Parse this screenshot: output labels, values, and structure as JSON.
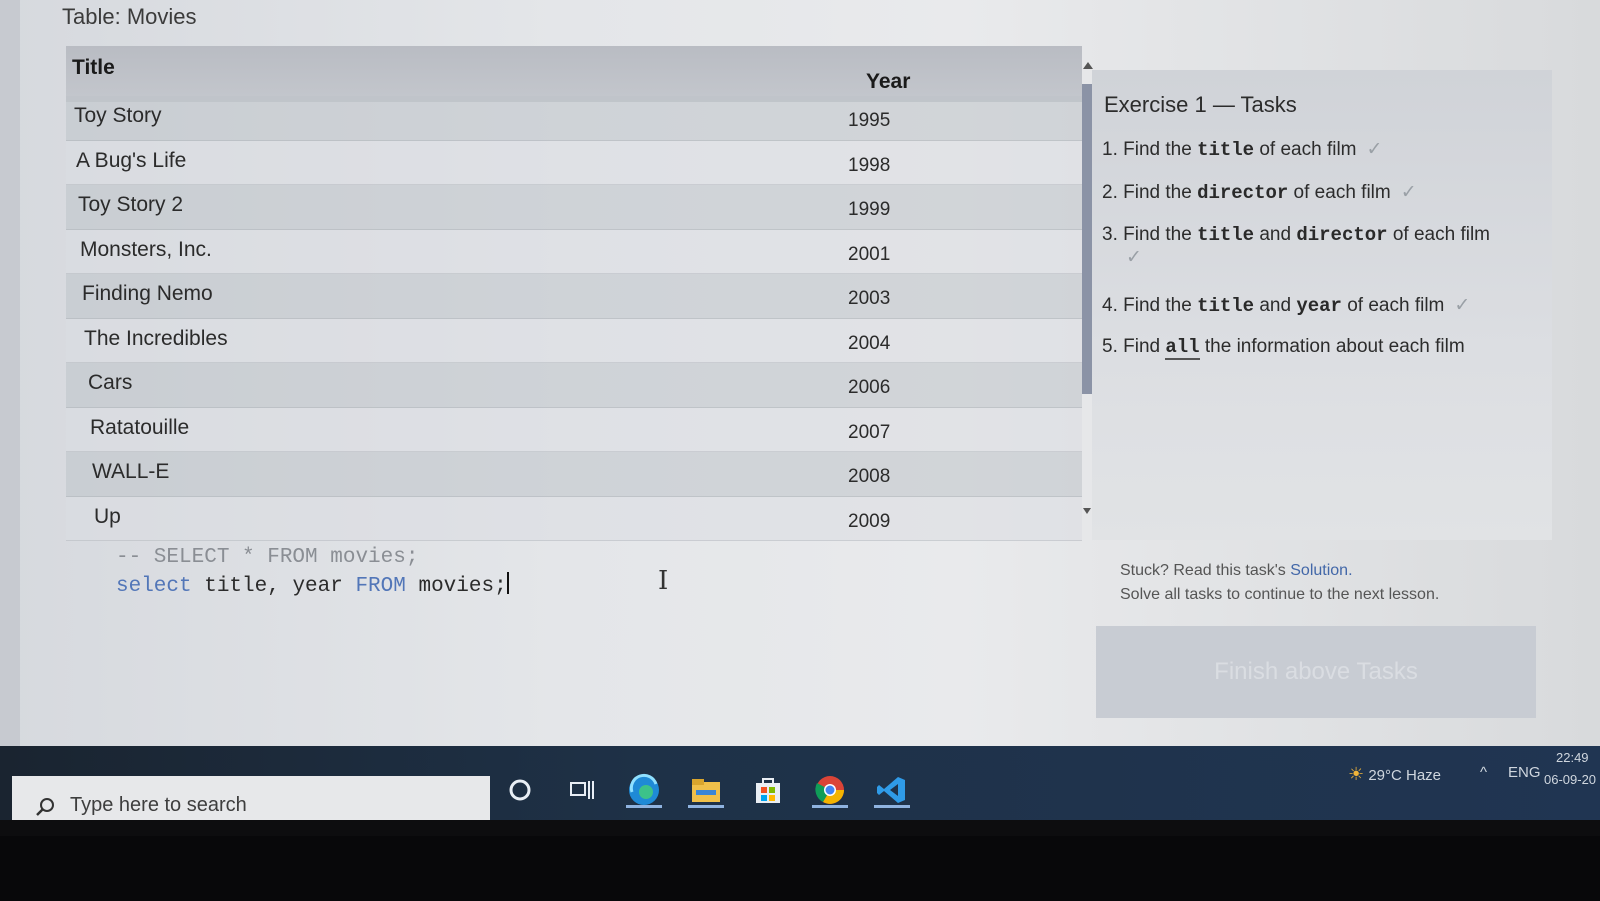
{
  "table": {
    "caption": "Table: Movies",
    "columns": [
      "Title",
      "Year"
    ],
    "rows": [
      {
        "title": "Toy Story",
        "year": "1995"
      },
      {
        "title": "A Bug's Life",
        "year": "1998"
      },
      {
        "title": "Toy Story 2",
        "year": "1999"
      },
      {
        "title": "Monsters, Inc.",
        "year": "2001"
      },
      {
        "title": "Finding Nemo",
        "year": "2003"
      },
      {
        "title": "The Incredibles",
        "year": "2004"
      },
      {
        "title": "Cars",
        "year": "2006"
      },
      {
        "title": "Ratatouille",
        "year": "2007"
      },
      {
        "title": "WALL-E",
        "year": "2008"
      },
      {
        "title": "Up",
        "year": "2009"
      }
    ]
  },
  "editor": {
    "line1": "-- SELECT * FROM movies;",
    "line2": {
      "kw1": "select",
      "mid": " title, year ",
      "kw2": "FROM",
      "end": " movies;"
    }
  },
  "tasks": {
    "title": "Exercise 1 — Tasks",
    "items": [
      {
        "prefix": "1. Find the ",
        "code1": "title",
        "middle": " of each film",
        "code2": "",
        "suffix": "",
        "check": "✓"
      },
      {
        "prefix": "2. Find the ",
        "code1": "director",
        "middle": " of each film",
        "code2": "",
        "suffix": "",
        "check": "✓"
      },
      {
        "prefix": "3. Find the ",
        "code1": "title",
        "middle": " and ",
        "code2": "director",
        "suffix": " of each film",
        "check": "✓"
      },
      {
        "prefix": "4. Find the ",
        "code1": "title",
        "middle": " and ",
        "code2": "year",
        "suffix": " of each film",
        "check": "✓"
      },
      {
        "prefix": "5. Find ",
        "code1": "all",
        "middle": " the information about each film",
        "code2": "",
        "suffix": "",
        "check": ""
      }
    ],
    "stuck_text": "Stuck? Read this task's ",
    "solution_link": "Solution.",
    "solve_text": "Solve all tasks to continue to the next lesson.",
    "finish_button": "Finish above Tasks"
  },
  "taskbar": {
    "search_placeholder": "Type here to search",
    "icons": [
      "cortana-icon",
      "task-view-icon",
      "edge-icon",
      "file-explorer-icon",
      "store-icon",
      "chrome-icon",
      "vscode-icon"
    ],
    "weather": "29°C  Haze",
    "language": "ENG",
    "time": "22:49",
    "date": "06-09-20"
  }
}
